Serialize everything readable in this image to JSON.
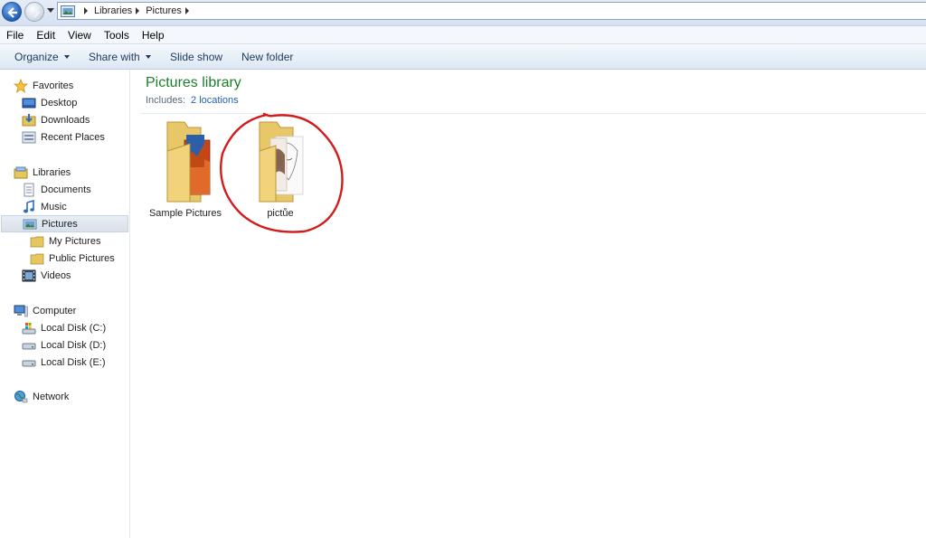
{
  "address_bar": {
    "breadcrumbs": [
      "Libraries",
      "Pictures"
    ]
  },
  "menu": [
    "File",
    "Edit",
    "View",
    "Tools",
    "Help"
  ],
  "commands": {
    "organize": "Organize",
    "share_with": "Share with",
    "slide_show": "Slide show",
    "new_folder": "New folder"
  },
  "navigation": {
    "favorites": {
      "label": "Favorites",
      "items": [
        "Desktop",
        "Downloads",
        "Recent Places"
      ]
    },
    "libraries": {
      "label": "Libraries",
      "items": [
        "Documents",
        "Music",
        "Pictures",
        "My Pictures",
        "Public Pictures",
        "Videos"
      ],
      "selected": "Pictures"
    },
    "computer": {
      "label": "Computer",
      "items": [
        "Local Disk (C:)",
        "Local Disk (D:)",
        "Local Disk (E:)"
      ]
    },
    "network": {
      "label": "Network"
    }
  },
  "library": {
    "title": "Pictures library",
    "includes_label": "Includes:",
    "locations_link": "2 locations"
  },
  "folders": [
    {
      "name": "Sample Pictures"
    },
    {
      "name": "pictůe"
    }
  ],
  "annotation": {
    "color": "#d41b1b",
    "shape": "hand-drawn circle around pictůe folder"
  },
  "colors": {
    "title_green": "#1e7d2d",
    "link_blue": "#1f5fb8",
    "accent_blue": "#1f5db8"
  }
}
